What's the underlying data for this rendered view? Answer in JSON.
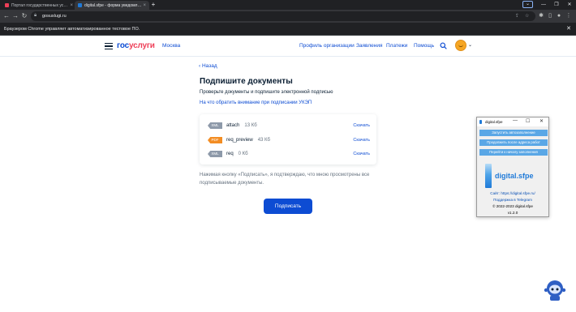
{
  "browser": {
    "tabs": [
      {
        "title": "Портал государственных услуг",
        "active": false,
        "favicon_color": "#ee3f58"
      },
      {
        "title": "digital.sfpe - форма уведомления",
        "active": true,
        "favicon_color": "#1f7ad8"
      }
    ],
    "url": "gosuslugi.ru",
    "infobar_message": "Браузером Chrome управляет автоматизированное тестовое ПО."
  },
  "header": {
    "logo_part1": "гос",
    "logo_part2": "услуги",
    "region": "Москва",
    "nav": [
      "Профиль организации",
      "Заявления",
      "Платежи",
      "Помощь"
    ]
  },
  "main": {
    "back_label": "Назад",
    "title": "Подпишите документы",
    "lead": "Проверьте документы и подпишите электронной подписью",
    "hint_link": "На что обратить внимание при подписании УКЭП",
    "files": [
      {
        "type": "XML",
        "name": "attach",
        "size": "13 Кб",
        "download": "Скачать"
      },
      {
        "type": "PDF",
        "name": "req_preview",
        "size": "43 Кб",
        "download": "Скачать"
      },
      {
        "type": "XML",
        "name": "req",
        "size": "0 Кб",
        "download": "Скачать"
      }
    ],
    "consent": "Нажимая кнопку «Подписать», я подтверждаю, что мною просмотрены все подписываемые документы.",
    "sign_button": "Подписать"
  },
  "extension": {
    "window_title": "digital.sfpe",
    "buttons": [
      "Запустить автозаполнение",
      "Продолжить после адреса работ",
      "Перейти к началу заполнения"
    ],
    "logo_text": "digital.sfpe",
    "site_line": "Сайт: https://digital.sfpe.ru/",
    "telegram_line": "Поддержка в Telegram",
    "copyright": "© 2022-2023 digital.sfpe",
    "version": "v1.2.0"
  },
  "colors": {
    "brand_blue": "#0d4cd3",
    "brand_red": "#ee3f58",
    "pdf_badge": "#f38d23",
    "xml_badge": "#8d99a9",
    "extension_button": "#5aa7e6"
  }
}
